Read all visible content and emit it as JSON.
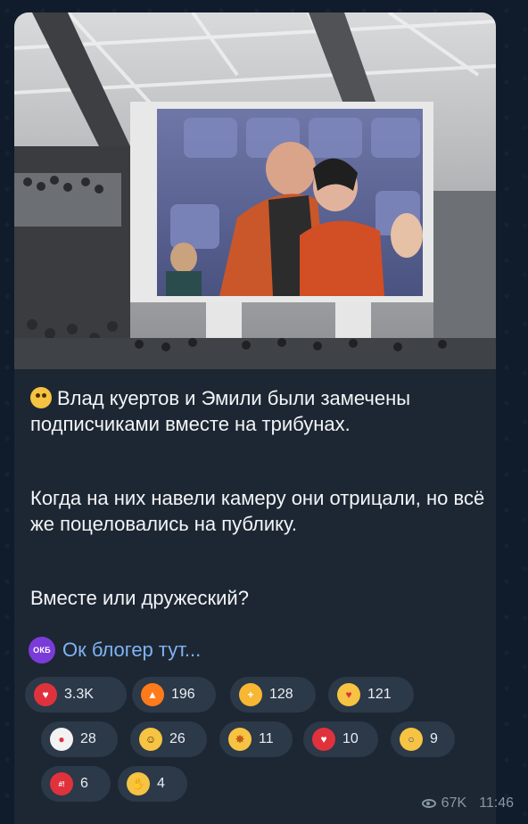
{
  "post": {
    "paragraph1": "Влад куертов и Эмили были замечены подписчиками вместе на трибунах.",
    "paragraph2": "Когда на них навели камеру они отрицали, но всё же поцеловались на публику.",
    "paragraph3": "Вместе или дружеский?"
  },
  "channel": {
    "badge": "ОКБ",
    "name": "Ок блогер тут..."
  },
  "reactions": [
    {
      "icon": "heart-icon",
      "count": "3.3K",
      "color": "#e0323c"
    },
    {
      "icon": "fire-icon",
      "count": "196",
      "color": "#ff7a1a"
    },
    {
      "icon": "thumbs-up-icon",
      "count": "128",
      "color": "#f7b733"
    },
    {
      "icon": "smiling-face-with-hearts-icon",
      "count": "121",
      "color": "#f6c343"
    },
    {
      "icon": "clown-face-icon",
      "count": "28",
      "color": "#f2f2f2"
    },
    {
      "icon": "grinning-face-icon",
      "count": "26",
      "color": "#f6c343"
    },
    {
      "icon": "exploding-head-icon",
      "count": "11",
      "color": "#f6c343"
    },
    {
      "icon": "broken-heart-icon",
      "count": "10",
      "color": "#e0323c"
    },
    {
      "icon": "screaming-face-icon",
      "count": "9",
      "color": "#f6c343"
    },
    {
      "icon": "cursing-face-icon",
      "count": "6",
      "color": "#e0323c"
    },
    {
      "icon": "clapping-hands-icon",
      "count": "4",
      "color": "#f6c343"
    }
  ],
  "meta": {
    "views": "67K",
    "time": "11:46"
  }
}
